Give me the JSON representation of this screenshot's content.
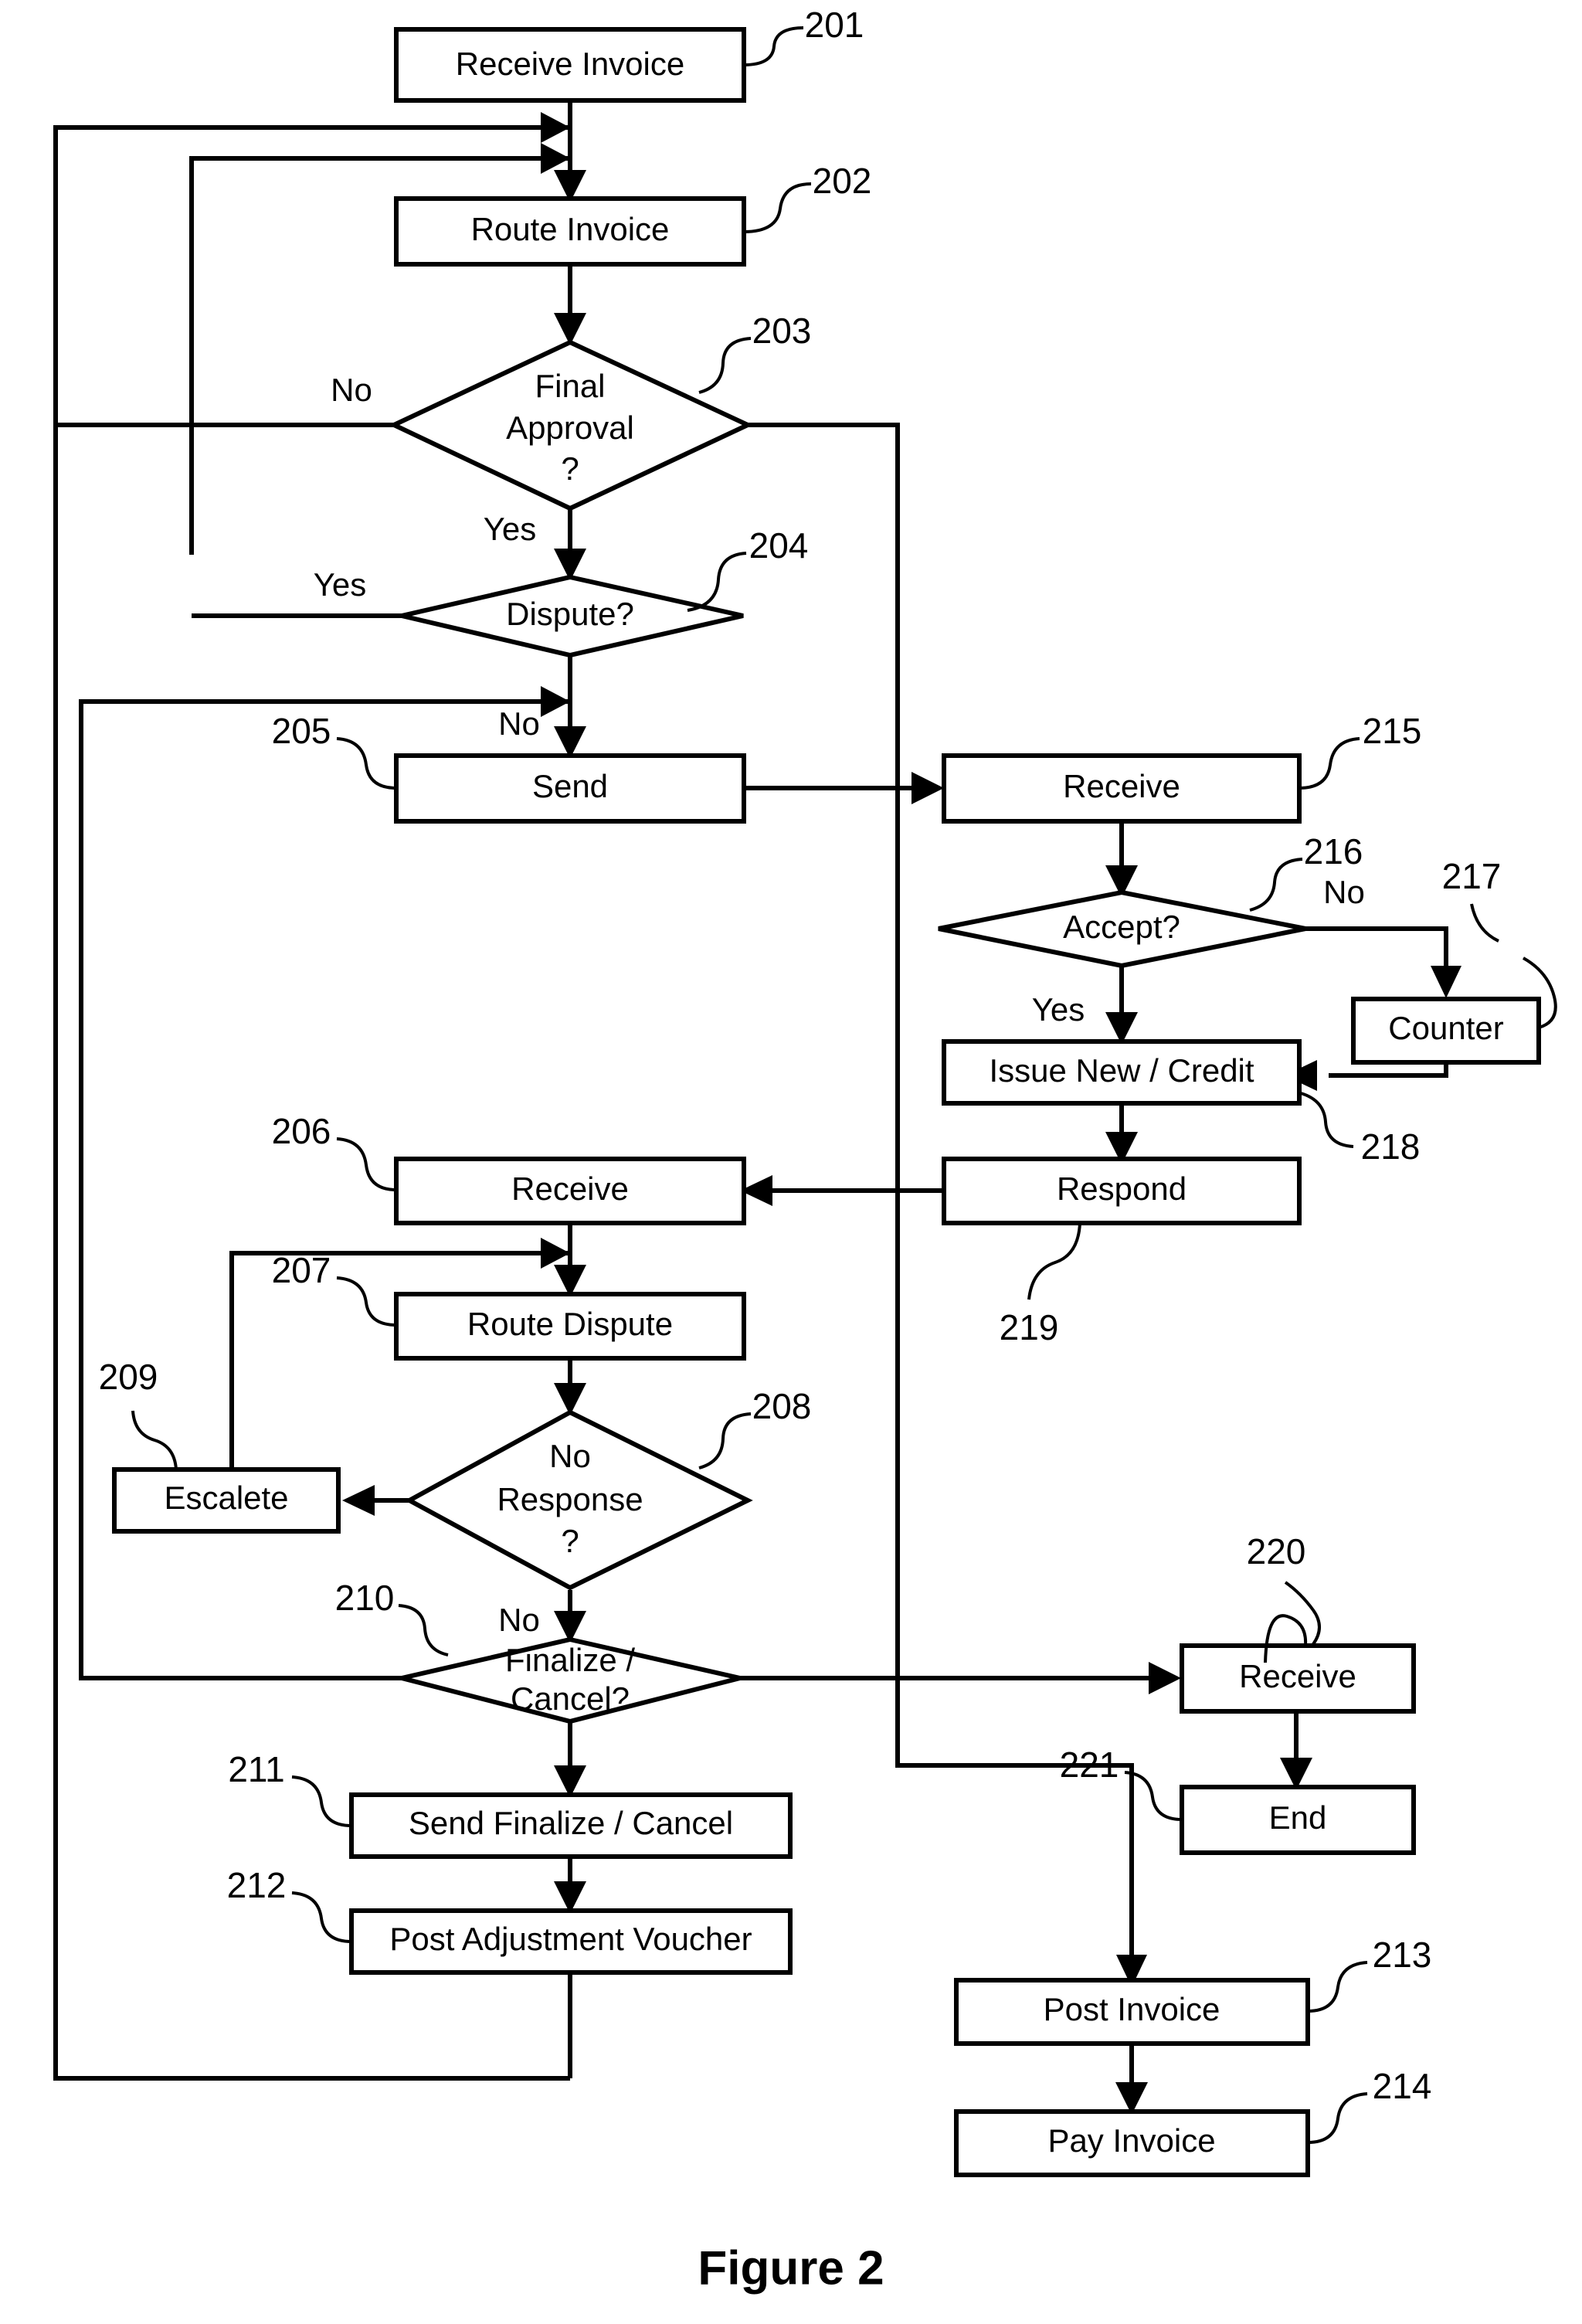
{
  "figure": {
    "caption": "Figure 2"
  },
  "nodes": [
    {
      "id": "201",
      "ref": "201",
      "label": "Receive Invoice",
      "shape": "box"
    },
    {
      "id": "202",
      "ref": "202",
      "label": "Route Invoice",
      "shape": "box"
    },
    {
      "id": "203",
      "ref": "203",
      "label": "Final Approval ?",
      "label_line1": "Final",
      "label_line2": "Approval",
      "label_line3": "?",
      "shape": "diamond"
    },
    {
      "id": "204",
      "ref": "204",
      "label": "Dispute?",
      "shape": "diamond"
    },
    {
      "id": "205",
      "ref": "205",
      "label": "Send",
      "shape": "box"
    },
    {
      "id": "206",
      "ref": "206",
      "label": "Receive",
      "shape": "box"
    },
    {
      "id": "207",
      "ref": "207",
      "label": "Route Dispute",
      "shape": "box"
    },
    {
      "id": "208",
      "ref": "208",
      "label": "No Response ?",
      "label_line1": "No",
      "label_line2": "Response",
      "label_line3": "?",
      "shape": "diamond"
    },
    {
      "id": "209",
      "ref": "209",
      "label": "Escalete",
      "shape": "box"
    },
    {
      "id": "210",
      "ref": "210",
      "label": "Finalize / Cancel?",
      "label_line1": "Finalize /",
      "label_line2": "Cancel?",
      "shape": "diamond"
    },
    {
      "id": "211",
      "ref": "211",
      "label": "Send Finalize / Cancel",
      "shape": "box"
    },
    {
      "id": "212",
      "ref": "212",
      "label": "Post Adjustment Voucher",
      "shape": "box"
    },
    {
      "id": "213",
      "ref": "213",
      "label": "Post Invoice",
      "shape": "box"
    },
    {
      "id": "214",
      "ref": "214",
      "label": "Pay Invoice",
      "shape": "box"
    },
    {
      "id": "215",
      "ref": "215",
      "label": "Receive",
      "shape": "box"
    },
    {
      "id": "216",
      "ref": "216",
      "label": "Accept?",
      "shape": "diamond"
    },
    {
      "id": "217",
      "ref": "217",
      "label": "Counter",
      "shape": "box"
    },
    {
      "id": "218",
      "ref": "218",
      "label": "Issue New / Credit",
      "shape": "box"
    },
    {
      "id": "219",
      "ref": "219",
      "label": "Respond",
      "shape": "box"
    },
    {
      "id": "220",
      "ref": "220",
      "label": "Receive",
      "shape": "box"
    },
    {
      "id": "221",
      "ref": "221",
      "label": "End",
      "shape": "box"
    }
  ],
  "edge_labels": {
    "final_approval_no": "No",
    "final_approval_yes": "Yes",
    "dispute_yes": "Yes",
    "dispute_no": "No",
    "accept_no": "No",
    "accept_yes": "Yes",
    "no_response_no": "No"
  },
  "colors": {
    "stroke": "#000000",
    "fill": "#ffffff",
    "text": "#000000"
  }
}
